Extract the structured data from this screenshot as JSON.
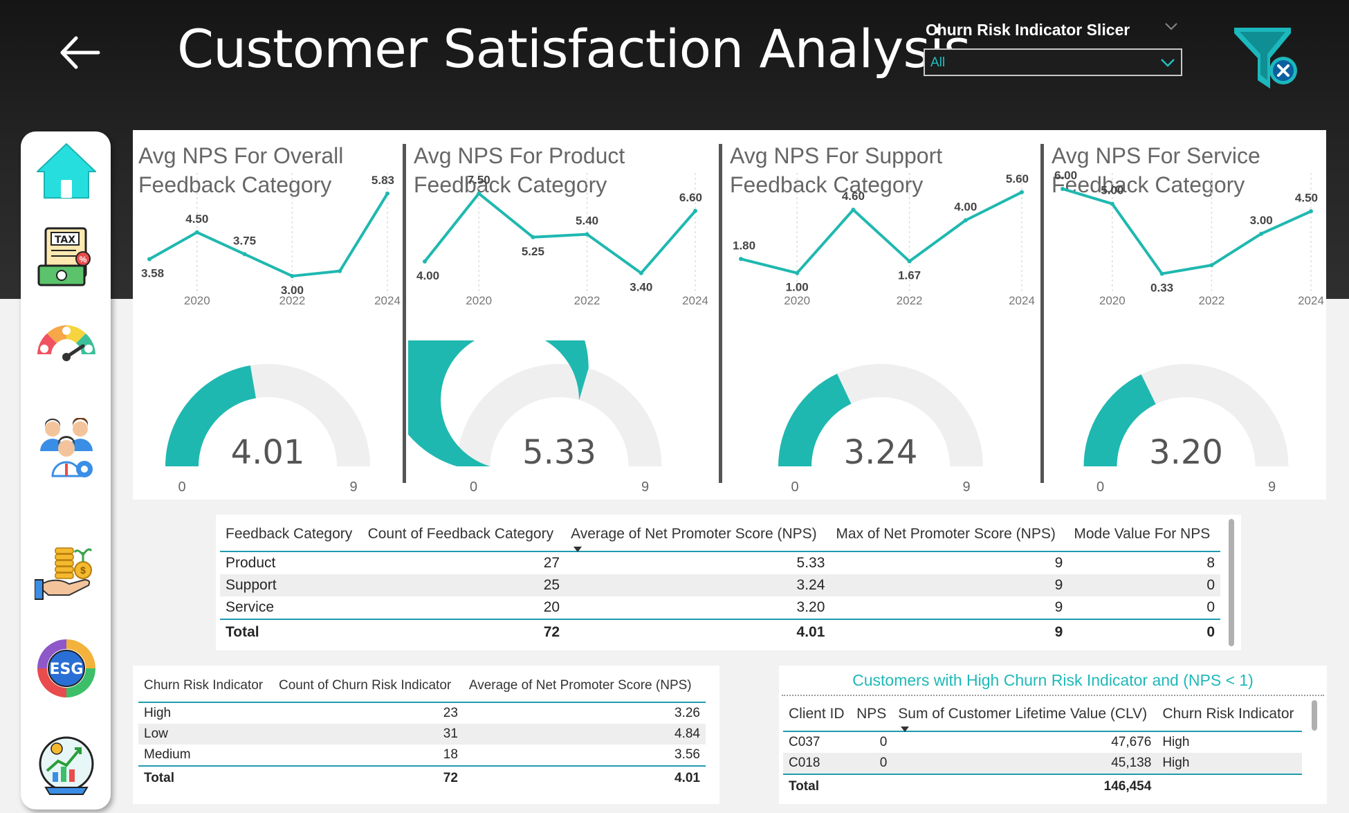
{
  "header": {
    "title": "Customer Satisfaction Analysis",
    "slicer_label": "Churn Risk Indicator Slicer",
    "slicer_value": "All"
  },
  "colors": {
    "accent": "#1fb8b0",
    "gauge_track": "#efefef",
    "header_bg": "#1b1b1b"
  },
  "sidebar": {
    "items": [
      {
        "icon": "home-icon"
      },
      {
        "icon": "tax-icon"
      },
      {
        "icon": "satisfaction-gauge-icon"
      },
      {
        "icon": "team-settings-icon"
      },
      {
        "icon": "investment-hand-icon"
      },
      {
        "icon": "esg-icon"
      },
      {
        "icon": "financial-growth-icon"
      }
    ]
  },
  "kpis": [
    {
      "title_line1": "Avg NPS For Overall",
      "title_line2": "Feedback Category",
      "gauge_value": "4.01",
      "gauge_min": "0",
      "gauge_max": "9",
      "chart_data": {
        "type": "line",
        "x": [
          2019,
          2020,
          2021,
          2022,
          2023,
          2024
        ],
        "values": [
          3.58,
          4.5,
          3.75,
          3.0,
          3.17,
          5.83
        ],
        "labels": [
          "3.58",
          "4.50",
          "3.75",
          "3.00",
          "",
          "5.83"
        ],
        "tick_labels": [
          "2020",
          "2022",
          "2024"
        ],
        "ticks": [
          2020,
          2022,
          2024
        ],
        "ylim": [
          2.5,
          6.3
        ]
      }
    },
    {
      "title_line1": "Avg NPS For Product",
      "title_line2": "Feedback Category",
      "gauge_value": "5.33",
      "gauge_min": "0",
      "gauge_max": "9",
      "chart_data": {
        "type": "line",
        "x": [
          2019,
          2020,
          2021,
          2022,
          2023,
          2024
        ],
        "values": [
          4.0,
          7.5,
          5.25,
          5.4,
          3.4,
          6.6
        ],
        "labels": [
          "4.00",
          "7.50",
          "5.25",
          "5.40",
          "3.40",
          "6.60"
        ],
        "tick_labels": [
          "2020",
          "2022",
          "2024"
        ],
        "ticks": [
          2020,
          2022,
          2024
        ],
        "ylim": [
          2.5,
          8.2
        ]
      }
    },
    {
      "title_line1": "Avg NPS For Support",
      "title_line2": "Feedback Category",
      "gauge_value": "3.24",
      "gauge_min": "0",
      "gauge_max": "9",
      "chart_data": {
        "type": "line",
        "x": [
          2019,
          2020,
          2021,
          2022,
          2023,
          2024
        ],
        "values": [
          1.8,
          1.0,
          4.6,
          1.67,
          4.0,
          5.6
        ],
        "labels": [
          "1.80",
          "1.00",
          "4.60",
          "1.67",
          "4.00",
          "5.60"
        ],
        "tick_labels": [
          "2020",
          "2022",
          "2024"
        ],
        "ticks": [
          2020,
          2022,
          2024
        ],
        "ylim": [
          0.0,
          6.3
        ]
      }
    },
    {
      "title_line1": "Avg NPS For Service",
      "title_line2": "Feedback Category",
      "gauge_value": "3.20",
      "gauge_min": "0",
      "gauge_max": "9",
      "chart_data": {
        "type": "line",
        "x": [
          2019,
          2020,
          2021,
          2022,
          2023,
          2024
        ],
        "values": [
          6.0,
          5.0,
          0.33,
          0.9,
          3.0,
          4.5
        ],
        "labels": [
          "6.00",
          "5.00",
          "0.33",
          "",
          "3.00",
          "4.50"
        ],
        "tick_labels": [
          "2020",
          "2022",
          "2024"
        ],
        "ticks": [
          2020,
          2022,
          2024
        ],
        "ylim": [
          -0.8,
          6.6
        ]
      }
    }
  ],
  "feedback_table": {
    "columns": [
      "Feedback Category",
      "Count of Feedback Category",
      "Average of Net Promoter Score (NPS)",
      "Max of Net Promoter Score (NPS)",
      "Mode Value For NPS"
    ],
    "rows": [
      [
        "Product",
        "27",
        "5.33",
        "9",
        "8"
      ],
      [
        "Support",
        "25",
        "3.24",
        "9",
        "0"
      ],
      [
        "Service",
        "20",
        "3.20",
        "9",
        "0"
      ]
    ],
    "total": [
      "Total",
      "72",
      "4.01",
      "9",
      "0"
    ]
  },
  "churn_table": {
    "columns": [
      "Churn Risk Indicator",
      "Count of Churn Risk Indicator",
      "Average of Net Promoter Score (NPS)"
    ],
    "rows": [
      [
        "High",
        "23",
        "3.26"
      ],
      [
        "Low",
        "31",
        "4.84"
      ],
      [
        "Medium",
        "18",
        "3.56"
      ]
    ],
    "total": [
      "Total",
      "72",
      "4.01"
    ]
  },
  "high_churn_table": {
    "title": "Customers with High Churn Risk Indicator and (NPS < 1)",
    "columns": [
      "Client ID",
      "NPS",
      "Sum of Customer Lifetime Value (CLV)",
      "Churn Risk Indicator"
    ],
    "rows": [
      [
        "C037",
        "0",
        "47,676",
        "High"
      ],
      [
        "C018",
        "0",
        "45,138",
        "High"
      ]
    ],
    "total": [
      "Total",
      "",
      "146,454",
      ""
    ]
  }
}
